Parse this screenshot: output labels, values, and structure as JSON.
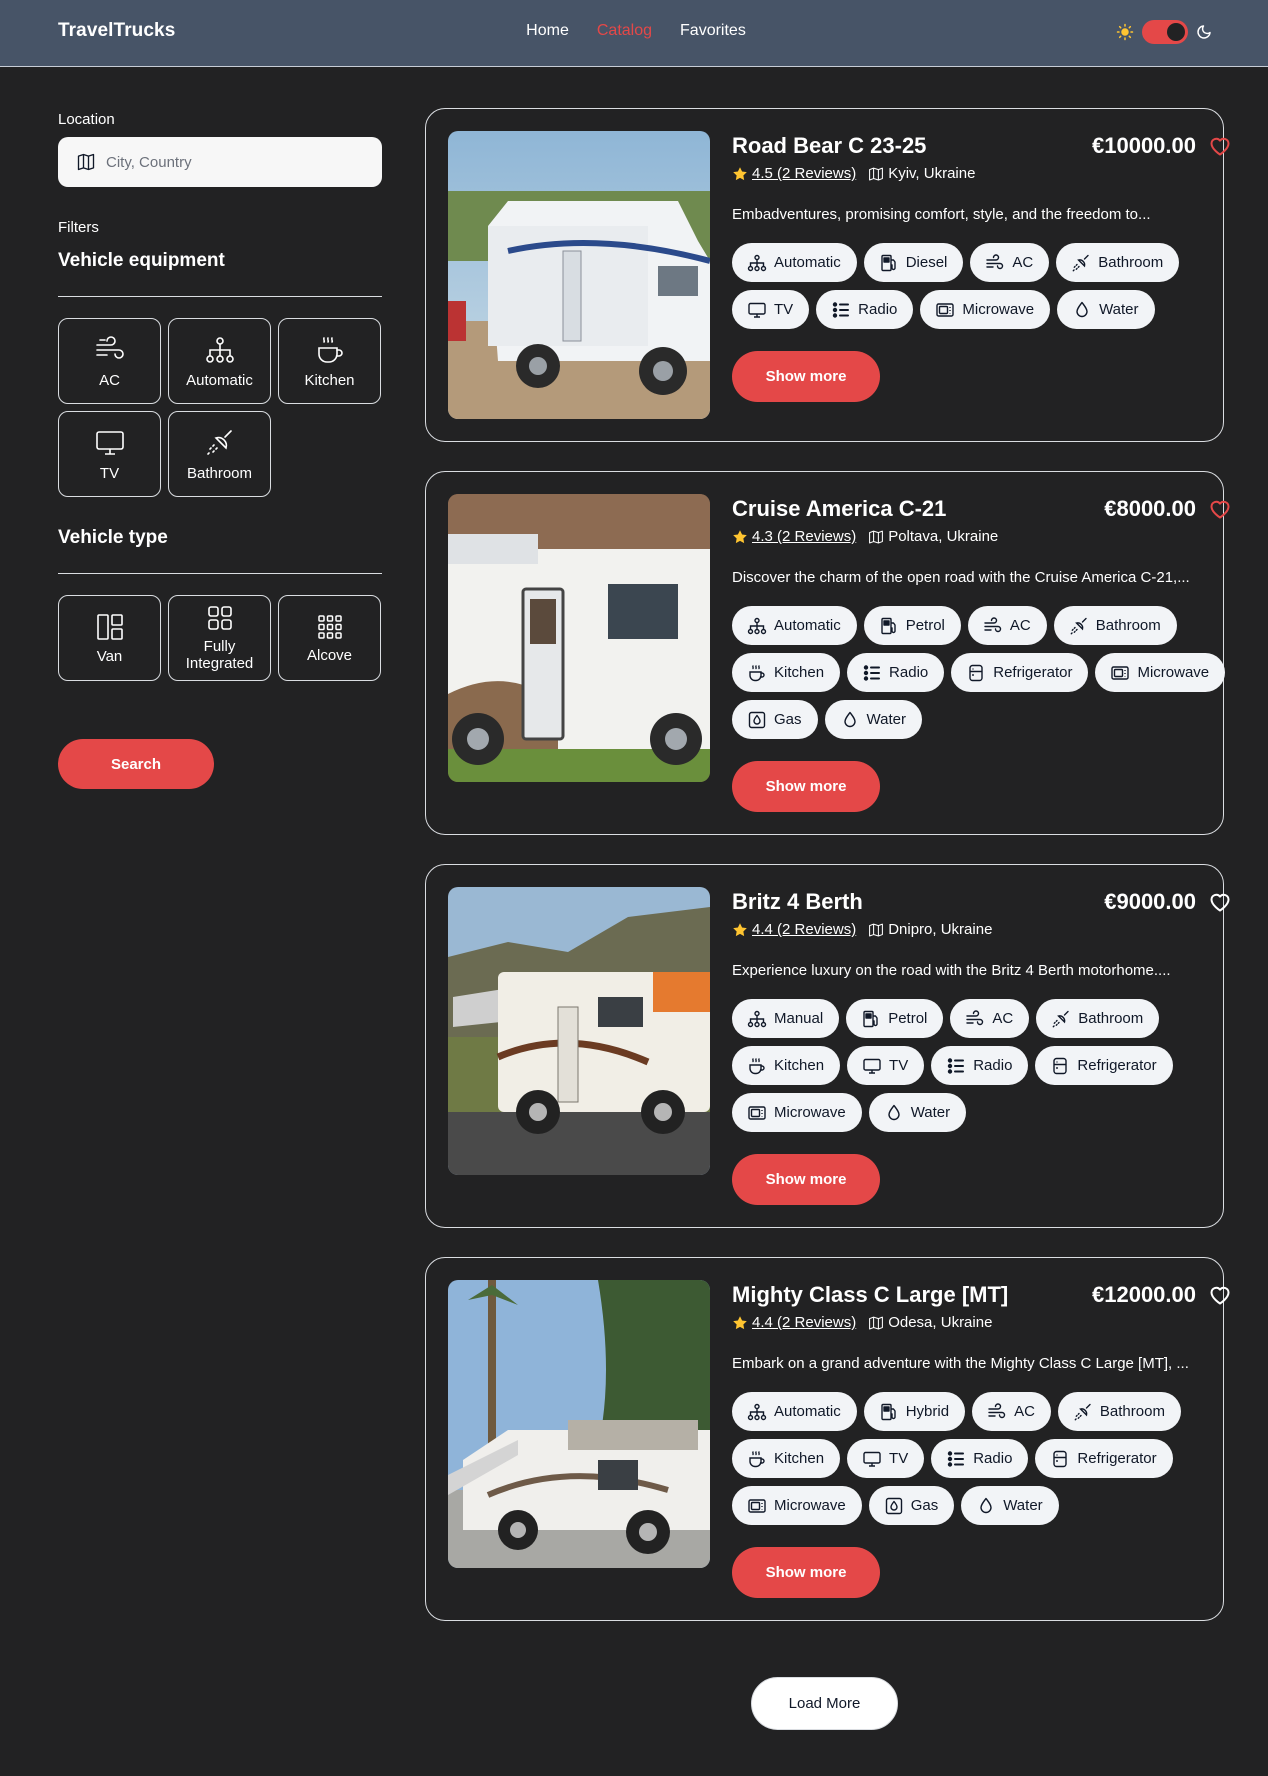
{
  "header": {
    "logo": "TravelTrucks",
    "nav": [
      {
        "label": "Home",
        "active": false
      },
      {
        "label": "Catalog",
        "active": true
      },
      {
        "label": "Favorites",
        "active": false
      }
    ],
    "theme": {
      "mode": "dark"
    }
  },
  "sidebar": {
    "location_label": "Location",
    "location_placeholder": "City, Country",
    "filters_label": "Filters",
    "equipment_title": "Vehicle equipment",
    "equipment": [
      {
        "label": "AC",
        "icon": "wind-icon"
      },
      {
        "label": "Automatic",
        "icon": "diagram-icon"
      },
      {
        "label": "Kitchen",
        "icon": "cup-hot-icon"
      },
      {
        "label": "TV",
        "icon": "tv-icon"
      },
      {
        "label": "Bathroom",
        "icon": "shower-icon"
      }
    ],
    "type_title": "Vehicle type",
    "types": [
      {
        "label": "Van",
        "icon": "grid-1x2-icon"
      },
      {
        "label": "Fully Integrated",
        "icon": "grid-2x2-icon"
      },
      {
        "label": "Alcove",
        "icon": "grid-3x3-icon"
      }
    ],
    "search_label": "Search"
  },
  "campers": [
    {
      "name": "Road Bear C 23-25",
      "price": "€10000.00",
      "favorite": true,
      "rating": "4.5 (2 Reviews)",
      "location": "Kyiv, Ukraine",
      "description": "Embadventures, promising comfort, style, and the freedom to...",
      "tags": [
        "Automatic",
        "Diesel",
        "AC",
        "Bathroom",
        "TV",
        "Radio",
        "Microwave",
        "Water"
      ],
      "show_more": "Show more"
    },
    {
      "name": "Cruise America C-21",
      "price": "€8000.00",
      "favorite": true,
      "rating": "4.3 (2 Reviews)",
      "location": "Poltava, Ukraine",
      "description": "Discover the charm of the open road with the Cruise America C-21,...",
      "tags": [
        "Automatic",
        "Petrol",
        "AC",
        "Bathroom",
        "Kitchen",
        "Radio",
        "Refrigerator",
        "Microwave",
        "Gas",
        "Water"
      ],
      "show_more": "Show more"
    },
    {
      "name": "Britz 4 Berth",
      "price": "€9000.00",
      "favorite": false,
      "rating": "4.4 (2 Reviews)",
      "location": "Dnipro, Ukraine",
      "description": "Experience luxury on the road with the Britz 4 Berth motorhome....",
      "tags": [
        "Manual",
        "Petrol",
        "AC",
        "Bathroom",
        "Kitchen",
        "TV",
        "Radio",
        "Refrigerator",
        "Microwave",
        "Water"
      ],
      "show_more": "Show more"
    },
    {
      "name": "Mighty Class C Large [MT]",
      "price": "€12000.00",
      "favorite": false,
      "rating": "4.4 (2 Reviews)",
      "location": "Odesa, Ukraine",
      "description": "Embark on a grand adventure with the Mighty Class C Large [MT], ...",
      "tags": [
        "Automatic",
        "Hybrid",
        "AC",
        "Bathroom",
        "Kitchen",
        "TV",
        "Radio",
        "Refrigerator",
        "Microwave",
        "Gas",
        "Water"
      ],
      "show_more": "Show more"
    }
  ],
  "load_more": "Load More",
  "colors": {
    "accent": "#e44848",
    "background": "#222223",
    "header": "#475467",
    "tag_bg": "#f2f4f7",
    "star": "#ffc531"
  }
}
